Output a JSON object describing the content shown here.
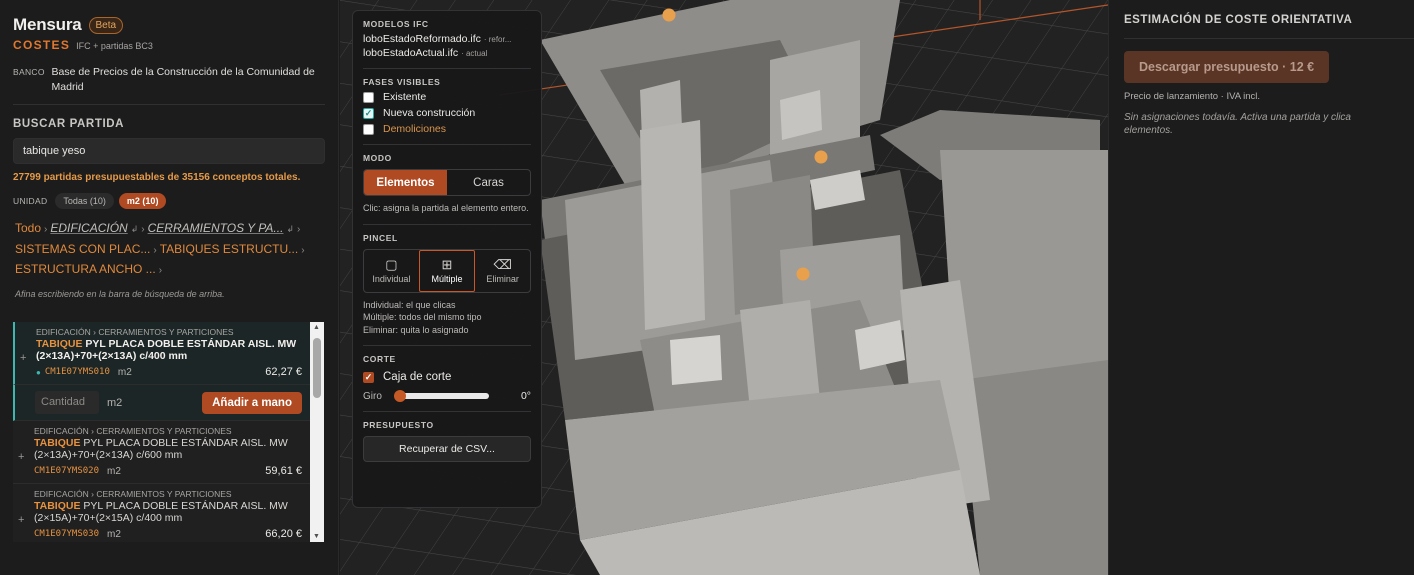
{
  "brand": {
    "name": "Mensura",
    "badge": "Beta",
    "module": "COSTES",
    "subtitle": "IFC + partidas BC3"
  },
  "banco": {
    "label": "BANCO",
    "value": "Base de Precios de la Construcción de la Comunidad de Madrid"
  },
  "search": {
    "section_title": "BUSCAR PARTIDA",
    "value": "tabique yeso",
    "count_text": "27799 partidas presupuestables de 35156 conceptos totales."
  },
  "unit_filter": {
    "label": "UNIDAD",
    "options": [
      {
        "label": "Todas (10)"
      },
      {
        "label": "m2 (10)"
      }
    ],
    "selected": "m2 (10)"
  },
  "breadcrumb": {
    "items": [
      "Todo",
      "EDIFICACIÓN",
      "CERRAMIENTOS Y PA...",
      "SISTEMAS CON PLAC...",
      "TABIQUES ESTRUCTU...",
      "ESTRUCTURA ANCHO ..."
    ]
  },
  "hint": "Afina escribiendo en la barra de búsqueda de arriba.",
  "results": [
    {
      "category": "EDIFICACIÓN › CERRAMIENTOS Y PARTICIONES",
      "tag": "TABIQUE",
      "title": "PYL PLACA DOBLE ESTÁNDAR AISL. MW (2×13A)+70+(2×13A) c/400 mm",
      "code": "CM1E07YMS010",
      "unit": "m2",
      "price": "62,27 €"
    },
    {
      "category": "EDIFICACIÓN › CERRAMIENTOS Y PARTICIONES",
      "tag": "TABIQUE",
      "title": "PYL PLACA DOBLE ESTÁNDAR AISL. MW (2×13A)+70+(2×13A) c/600 mm",
      "code": "CM1E07YMS020",
      "unit": "m2",
      "price": "59,61 €"
    },
    {
      "category": "EDIFICACIÓN › CERRAMIENTOS Y PARTICIONES",
      "tag": "TABIQUE",
      "title": "PYL PLACA DOBLE ESTÁNDAR AISL. MW (2×15A)+70+(2×15A) c/400 mm",
      "code": "CM1E07YMS030",
      "unit": "m2",
      "price": "66,20 €"
    }
  ],
  "add_row": {
    "qty_placeholder": "Cantidad",
    "unit": "m2",
    "button": "Añadir a mano"
  },
  "panel": {
    "models_title": "MODELOS IFC",
    "models": [
      {
        "name": "loboEstadoReformado.ifc",
        "tag": "· refor..."
      },
      {
        "name": "loboEstadoActual.ifc",
        "tag": "· actual"
      }
    ],
    "phases_title": "FASES VISIBLES",
    "phases": [
      {
        "label": "Existente",
        "checked": false
      },
      {
        "label": "Nueva construcción",
        "checked": true
      },
      {
        "label": "Demoliciones",
        "checked": false
      }
    ],
    "mode_title": "MODO",
    "mode_options": [
      "Elementos",
      "Caras"
    ],
    "mode_selected": "Elementos",
    "mode_hint": "Clic: asigna la partida al elemento entero.",
    "brush_title": "PINCEL",
    "brush_options": [
      {
        "label": "Individual",
        "icon": "square-icon"
      },
      {
        "label": "Múltiple",
        "icon": "grid-icon"
      },
      {
        "label": "Eliminar",
        "icon": "eraser-icon"
      }
    ],
    "brush_selected": "Múltiple",
    "brush_hint_1": "Individual: el que clicas",
    "brush_hint_2": "Múltiple: todos del mismo tipo",
    "brush_hint_3": "Eliminar: quita lo asignado",
    "cut_title": "CORTE",
    "cut_box_label": "Caja de corte",
    "cut_box_checked": true,
    "rotation_label": "Giro",
    "rotation_value": "0°",
    "rotation_fraction": 0,
    "budget_title": "PRESUPUESTO",
    "csv_button": "Recuperar de CSV..."
  },
  "right": {
    "title": "ESTIMACIÓN DE COSTE ORIENTATIVA",
    "download_button": "Descargar presupuesto · 12 €",
    "price_note": "Precio de lanzamiento · IVA incl.",
    "empty_text": "Sin asignaciones todavía. Activa una partida y clica elementos."
  },
  "colors": {
    "accent": "#b04a22",
    "accent_text": "#e0782f",
    "selection_teal": "#3bb8b0",
    "marker": "#e8a04c"
  }
}
